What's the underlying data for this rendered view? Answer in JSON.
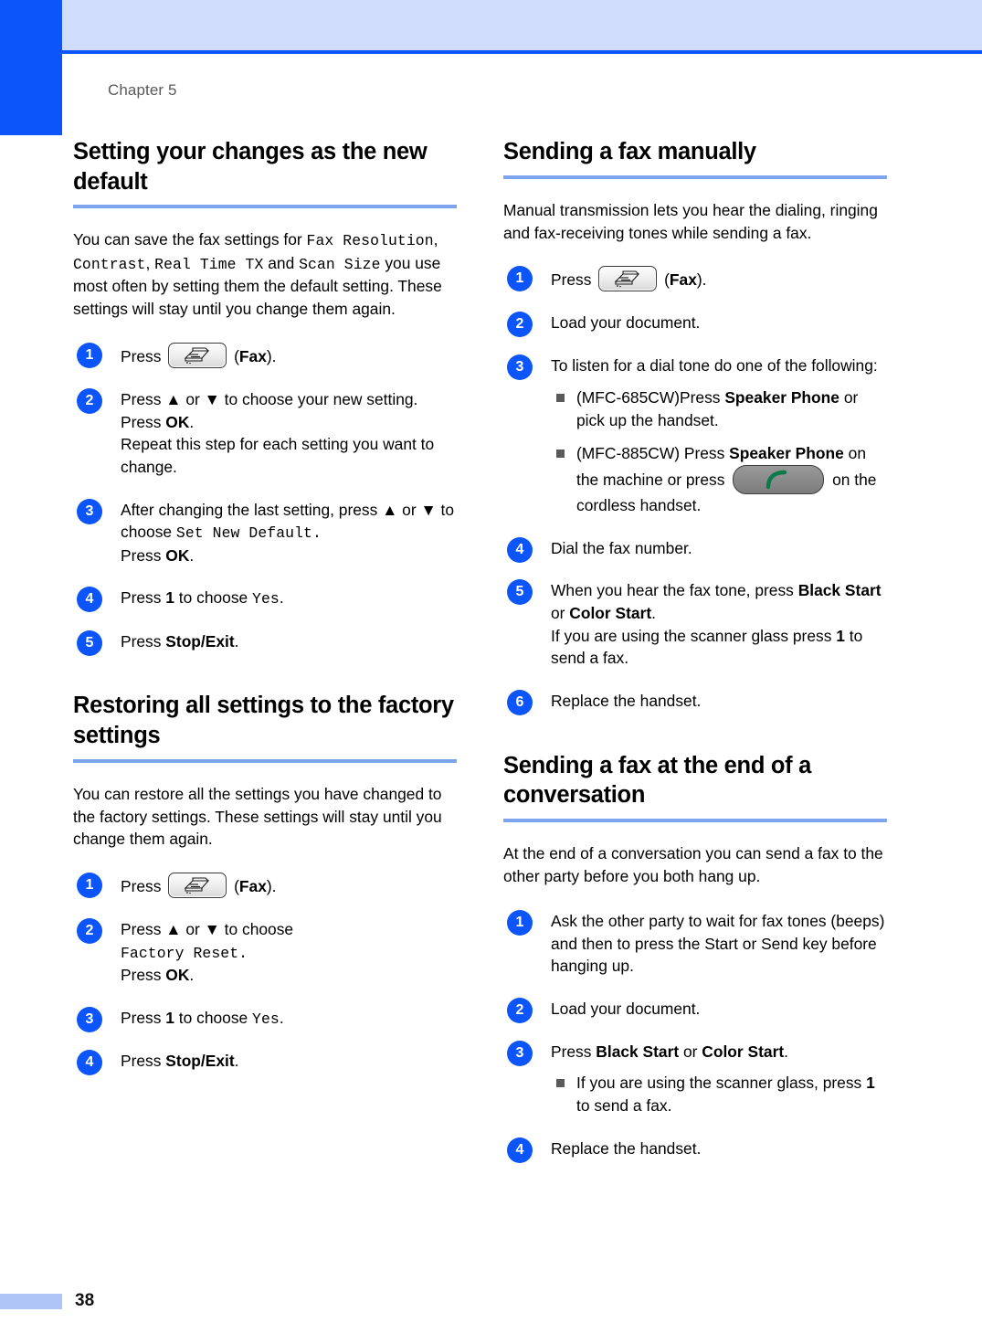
{
  "page": {
    "chapter_label": "Chapter 5",
    "page_number": "38",
    "accent_blue": "#0b55fa",
    "header_band_color": "#cfdcfb",
    "rule_color": "#7fa4ee",
    "footer_bar_color": "#aec4f7"
  },
  "left_column": {
    "section1": {
      "title": "Setting your changes as the new default",
      "intro_part1": "You can save the fax settings for ",
      "intro_mono1": "Fax Resolution",
      "intro_sep1": ", ",
      "intro_mono2": "Contrast",
      "intro_sep2": ", ",
      "intro_mono3": "Real Time TX",
      "intro_sep3": " and ",
      "intro_mono4": "Scan Size",
      "intro_part2": " you use most often by setting them the default setting. These settings will stay until you change them again.",
      "steps": [
        {
          "num": "1",
          "pre": "Press ",
          "icon": "fax-key-icon",
          "post_plain": " (",
          "post_bold": "Fax",
          "post_end": ")."
        },
        {
          "num": "2",
          "line1_a": "Press ▲ or ▼ to choose your new setting.",
          "line2_a": "Press ",
          "line2_bold": "OK",
          "line2_b": ".",
          "line3": "Repeat this step for each setting you want to change."
        },
        {
          "num": "3",
          "line1": "After changing the last setting, press ▲ or ▼ to choose ",
          "line1_mono": "Set New Default.",
          "line2_a": "Press ",
          "line2_bold": "OK",
          "line2_b": "."
        },
        {
          "num": "4",
          "pre": "Press ",
          "bold": "1",
          "mid": " to choose ",
          "mono": "Yes",
          "end": "."
        },
        {
          "num": "5",
          "pre": "Press ",
          "bold": "Stop/Exit",
          "end": "."
        }
      ]
    },
    "section2": {
      "title": "Restoring all settings to the factory settings",
      "intro": "You can restore all the settings you have changed to the factory settings. These settings will stay until you change them again.",
      "steps": [
        {
          "num": "1",
          "pre": "Press ",
          "icon": "fax-key-icon",
          "post_plain": " (",
          "post_bold": "Fax",
          "post_end": ")."
        },
        {
          "num": "2",
          "line1": "Press ▲ or ▼ to choose",
          "line2_mono": "Factory Reset.",
          "line3_a": "Press ",
          "line3_bold": "OK",
          "line3_b": "."
        },
        {
          "num": "3",
          "pre": "Press ",
          "bold": "1",
          "mid": " to choose ",
          "mono": "Yes",
          "end": "."
        },
        {
          "num": "4",
          "pre": "Press ",
          "bold": "Stop/Exit",
          "end": "."
        }
      ]
    }
  },
  "right_column": {
    "section1": {
      "title": "Sending a fax manually",
      "intro": "Manual transmission lets you hear the dialing, ringing and fax-receiving tones while sending a fax.",
      "steps": [
        {
          "num": "1",
          "pre": "Press ",
          "icon": "fax-key-icon",
          "post_plain": " (",
          "post_bold": "Fax",
          "post_end": ")."
        },
        {
          "num": "2",
          "text": "Load your document."
        },
        {
          "num": "3",
          "lead": "To listen for a dial tone do one of the following:",
          "bullets": [
            {
              "a": "(MFC-685CW)Press ",
              "bold": "Speaker Phone",
              "b": " or pick up the handset."
            },
            {
              "a": "(MFC-885CW) Press ",
              "bold": "Speaker Phone",
              "b": " on the machine or press ",
              "icon": "phone-key-icon",
              "c": " on the cordless handset."
            }
          ]
        },
        {
          "num": "4",
          "text": "Dial the fax number."
        },
        {
          "num": "5",
          "line1": "When you hear the fax tone, press ",
          "bold1": "Black Start",
          "mid1": " or ",
          "bold2": "Color Start",
          "end1": ".",
          "line2_a": "If you are using the scanner glass press ",
          "line2_bold": "1",
          "line2_b": " to send a fax."
        },
        {
          "num": "6",
          "text": "Replace the handset."
        }
      ]
    },
    "section2": {
      "title": "Sending a fax at the end of a conversation",
      "intro": "At the end of a conversation you can send a fax to the other party before you both hang up.",
      "steps": [
        {
          "num": "1",
          "text": "Ask the other party to wait for fax tones (beeps) and then to press the Start or Send key before hanging up."
        },
        {
          "num": "2",
          "text": "Load your document."
        },
        {
          "num": "3",
          "pre": "Press ",
          "bold1": "Black Start",
          "mid": " or ",
          "bold2": "Color Start",
          "end": ".",
          "bullets": [
            {
              "a": "If you are using the scanner glass, press ",
              "bold": "1",
              "b": " to send a fax."
            }
          ]
        },
        {
          "num": "4",
          "text": "Replace the handset."
        }
      ]
    }
  }
}
